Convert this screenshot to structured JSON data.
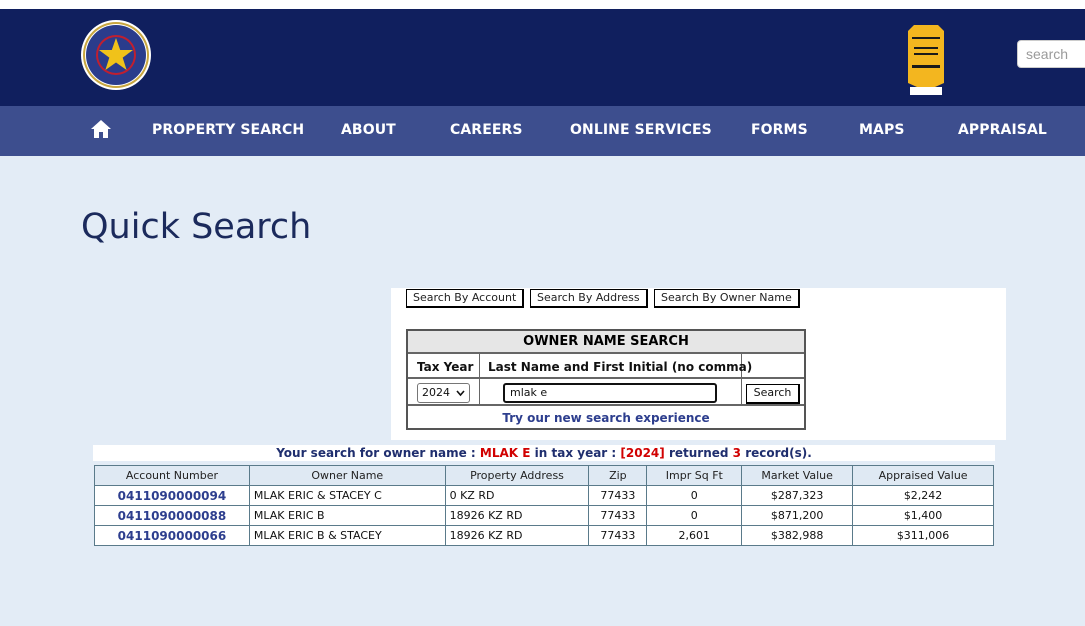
{
  "header": {
    "search_placeholder": "search"
  },
  "nav": {
    "items": [
      "PROPERTY SEARCH",
      "ABOUT",
      "CAREERS",
      "ONLINE SERVICES",
      "FORMS",
      "MAPS",
      "APPRAISAL"
    ]
  },
  "page": {
    "title": "Quick Search"
  },
  "search_tabs": {
    "account": "Search By Account",
    "address": "Search By Address",
    "owner": "Search By Owner Name"
  },
  "owner_form": {
    "title": "OWNER NAME SEARCH",
    "tax_year_label": "Tax Year",
    "name_label": "Last Name and First Initial (no comma)",
    "tax_year_value": "2024",
    "name_value": "mlak e",
    "search_button": "Search",
    "try_link": "Try our new search experience"
  },
  "result_summary": {
    "prefix": "Your search for owner name : ",
    "owner": "MLAK E",
    "middle": " in tax year : ",
    "year": "[2024]",
    "returned": " returned ",
    "count": "3",
    "suffix": " record(s)."
  },
  "results": {
    "columns": [
      "Account Number",
      "Owner Name",
      "Property Address",
      "Zip",
      "Impr Sq Ft",
      "Market Value",
      "Appraised Value"
    ],
    "rows": [
      [
        "0411090000094",
        "MLAK ERIC & STACEY C",
        "0 KZ RD",
        "77433",
        "0",
        "$287,323",
        "$2,242"
      ],
      [
        "0411090000088",
        "MLAK ERIC B",
        "18926 KZ RD",
        "77433",
        "0",
        "$871,200",
        "$1,400"
      ],
      [
        "0411090000066",
        "MLAK ERIC B & STACEY",
        "18926 KZ RD",
        "77433",
        "2,601",
        "$382,988",
        "$311,006"
      ]
    ]
  },
  "colors": {
    "header_bg": "#101f5e",
    "nav_bg": "#3d4e8e",
    "page_bg": "#e3ecf6",
    "link": "#2d3e8e",
    "highlight": "#d10000"
  }
}
